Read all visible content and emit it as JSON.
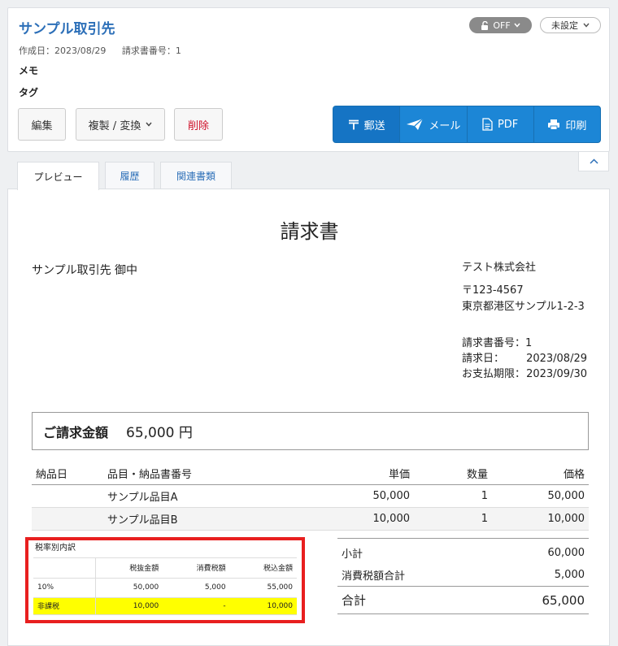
{
  "header": {
    "title": "サンプル取引先",
    "created_label": "作成日：2023/08/29",
    "invoice_no_label": "請求書番号：1",
    "memo_label": "メモ",
    "tag_label": "タグ",
    "toggle_label": "OFF",
    "status_label": "未設定",
    "buttons": {
      "edit": "編集",
      "copy": "複製 / 変換",
      "delete": "削除"
    },
    "actions": {
      "mail_post": "郵送",
      "email": "メール",
      "pdf": "PDF",
      "print": "印刷"
    }
  },
  "tabs": [
    {
      "label": "プレビュー",
      "active": true
    },
    {
      "label": "履歴",
      "active": false
    },
    {
      "label": "関連書類",
      "active": false
    }
  ],
  "document": {
    "title": "請求書",
    "client": "サンプル取引先 御中",
    "sender": {
      "company": "テスト株式会社",
      "postal": "〒123-4567",
      "address": "東京都港区サンプル1-2-3"
    },
    "info": [
      {
        "k": "請求書番号：",
        "v": "1"
      },
      {
        "k": "請求日：",
        "v": "2023/08/29"
      },
      {
        "k": "お支払期限：",
        "v": "2023/09/30"
      }
    ],
    "amount_label": "ご請求金額",
    "amount_value": "65,000 円",
    "items_header": [
      "納品日",
      "品目・納品書番号",
      "単価",
      "数量",
      "価格"
    ],
    "items": [
      {
        "date": "",
        "name": "サンプル品目A",
        "price": "50,000",
        "qty": "1",
        "total": "50,000"
      },
      {
        "date": "",
        "name": "サンプル品目B",
        "price": "10,000",
        "qty": "1",
        "total": "10,000"
      }
    ],
    "tax_breakdown": {
      "title": "税率別内訳",
      "header": [
        "",
        "税抜金額",
        "消費税額",
        "税込金額"
      ],
      "rows": [
        [
          "10%",
          "50,000",
          "5,000",
          "55,000"
        ],
        [
          "非課税",
          "10,000",
          "-",
          "10,000"
        ]
      ]
    },
    "totals": {
      "subtotal_label": "小計",
      "subtotal": "60,000",
      "tax_label": "消費税額合計",
      "tax": "5,000",
      "grand_label": "合計",
      "grand": "65,000"
    }
  },
  "colors": {
    "accent": "#2c6fb8",
    "primary_button": "#1c86d6",
    "delete": "#d0122a",
    "highlight_box": "#e81f1f",
    "highlight_row": "#ffff00"
  }
}
